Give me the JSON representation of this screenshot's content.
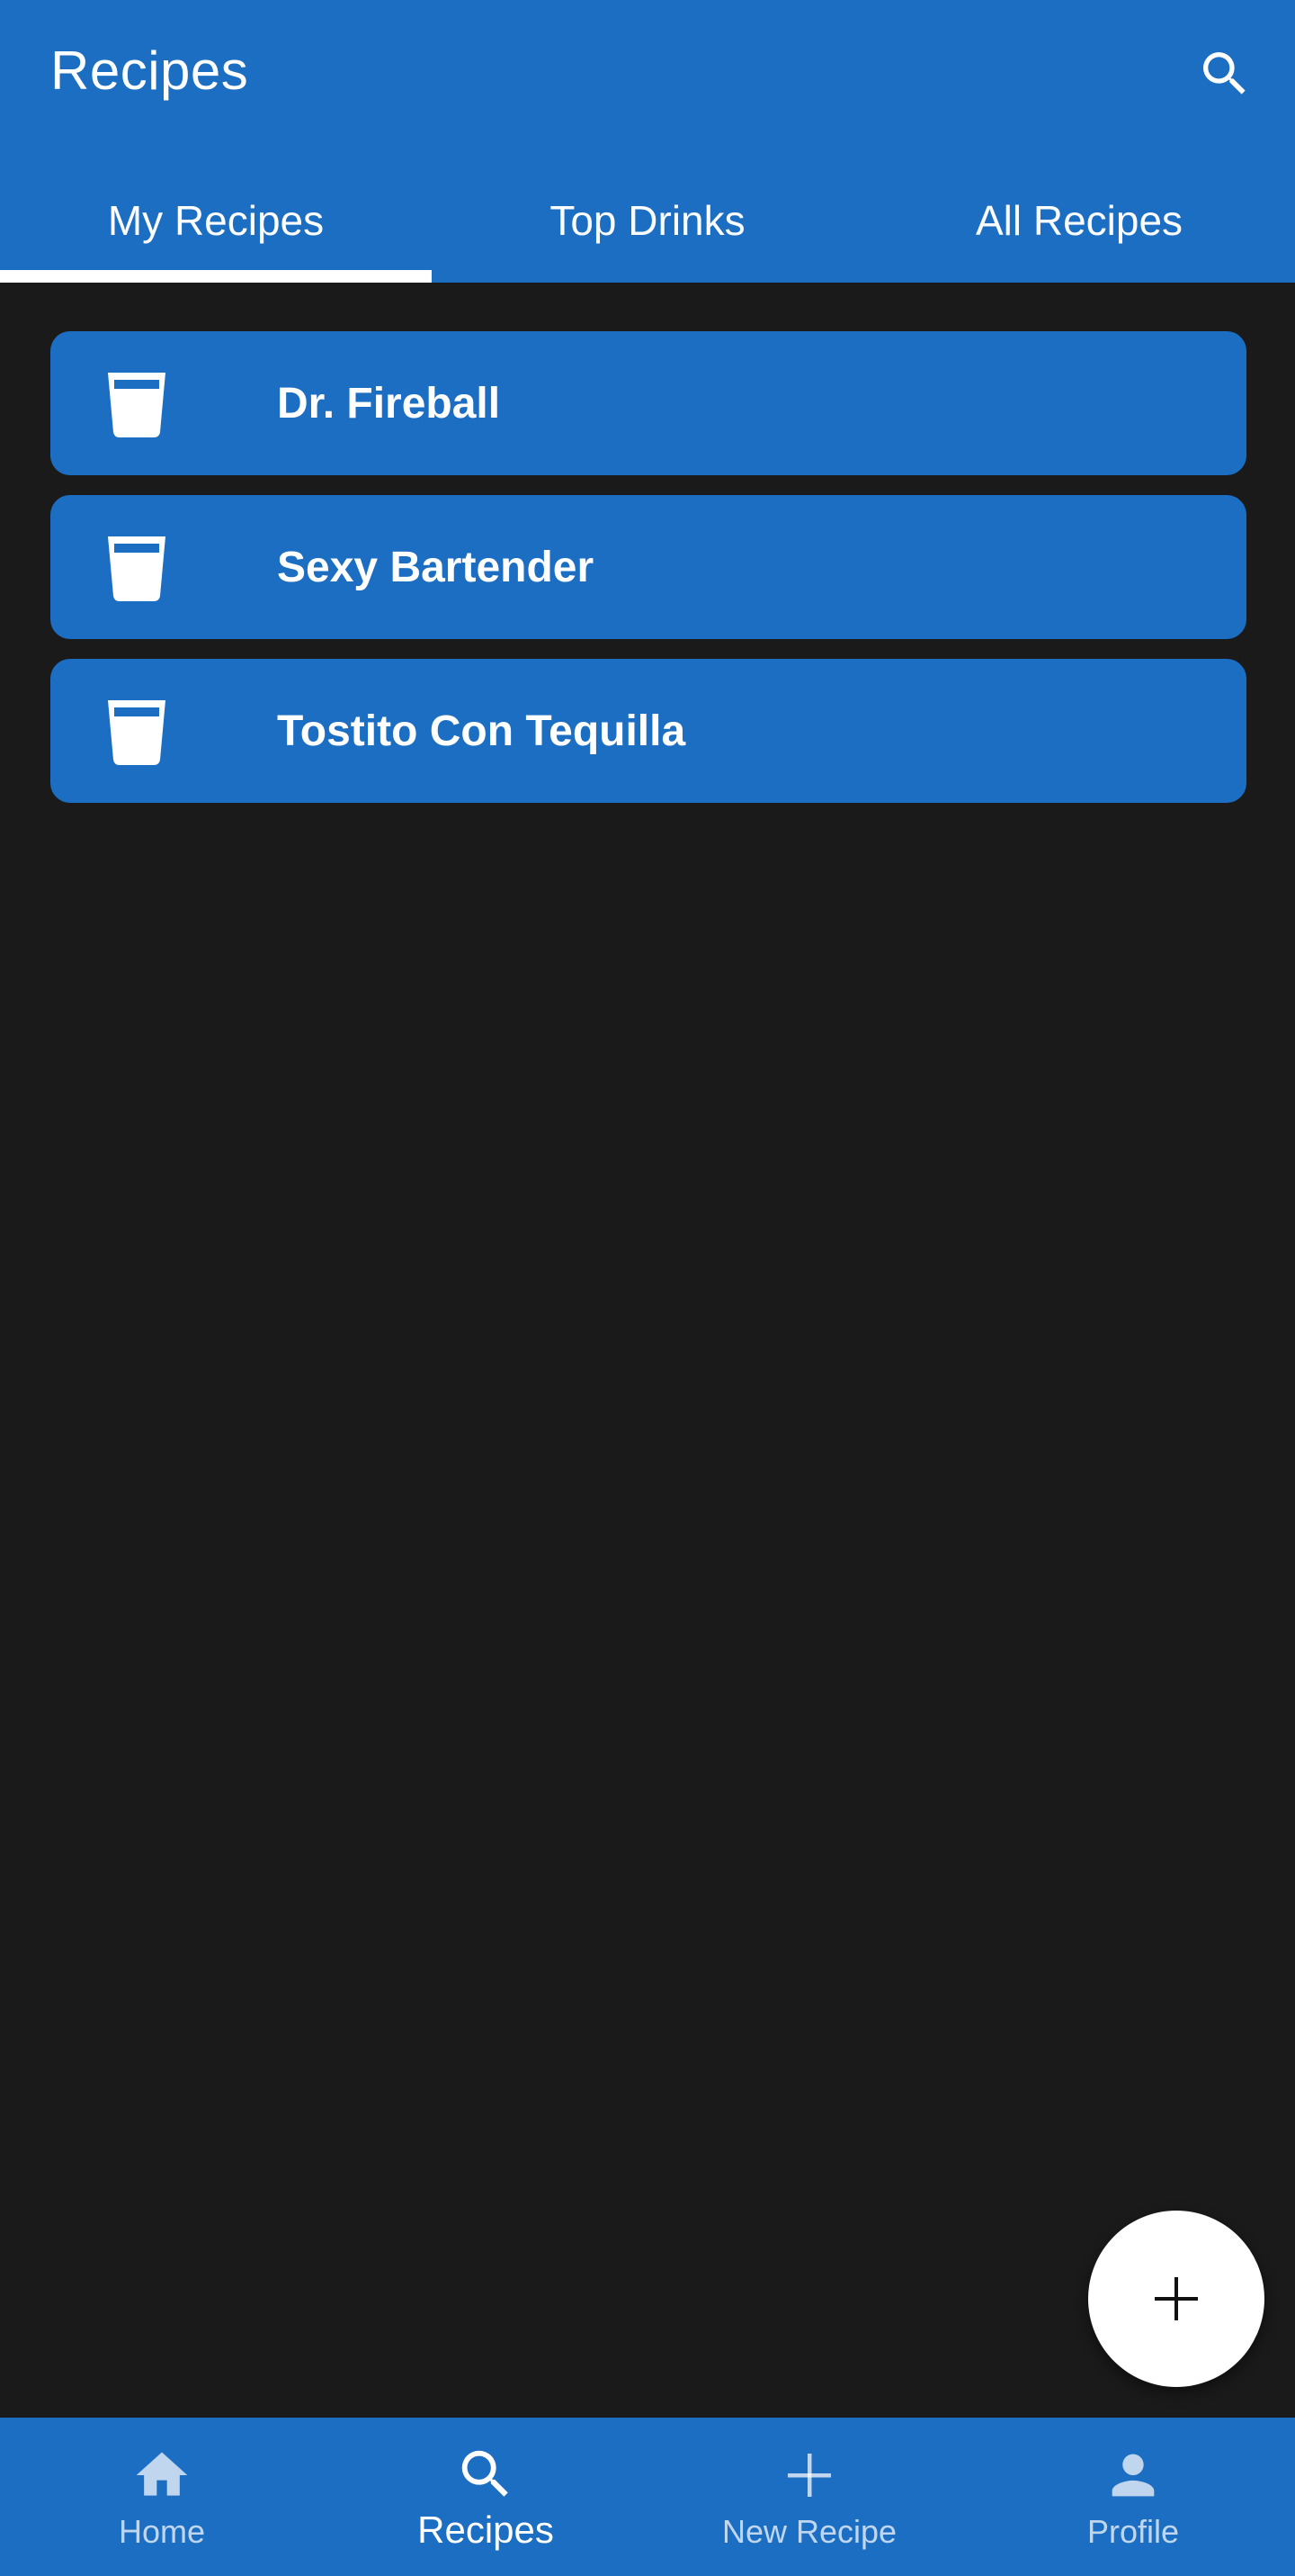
{
  "app_bar": {
    "title": "Recipes",
    "search_icon": "search-icon"
  },
  "tabs": [
    {
      "label": "My Recipes",
      "active": true
    },
    {
      "label": "Top Drinks",
      "active": false
    },
    {
      "label": "All Recipes",
      "active": false
    }
  ],
  "recipes": [
    {
      "name": "Dr. Fireball",
      "icon": "glass-icon"
    },
    {
      "name": "Sexy Bartender",
      "icon": "glass-icon"
    },
    {
      "name": "Tostito Con Tequilla",
      "icon": "glass-icon"
    }
  ],
  "fab": {
    "icon": "plus-icon"
  },
  "bottom_nav": [
    {
      "label": "Home",
      "icon": "home-icon",
      "active": false
    },
    {
      "label": "Recipes",
      "icon": "search-icon",
      "active": true
    },
    {
      "label": "New Recipe",
      "icon": "plus-icon",
      "active": false
    },
    {
      "label": "Profile",
      "icon": "person-icon",
      "active": false
    }
  ],
  "colors": {
    "primary": "#1b6ec2",
    "background": "#1a1a1a",
    "on_primary": "#ffffff"
  }
}
